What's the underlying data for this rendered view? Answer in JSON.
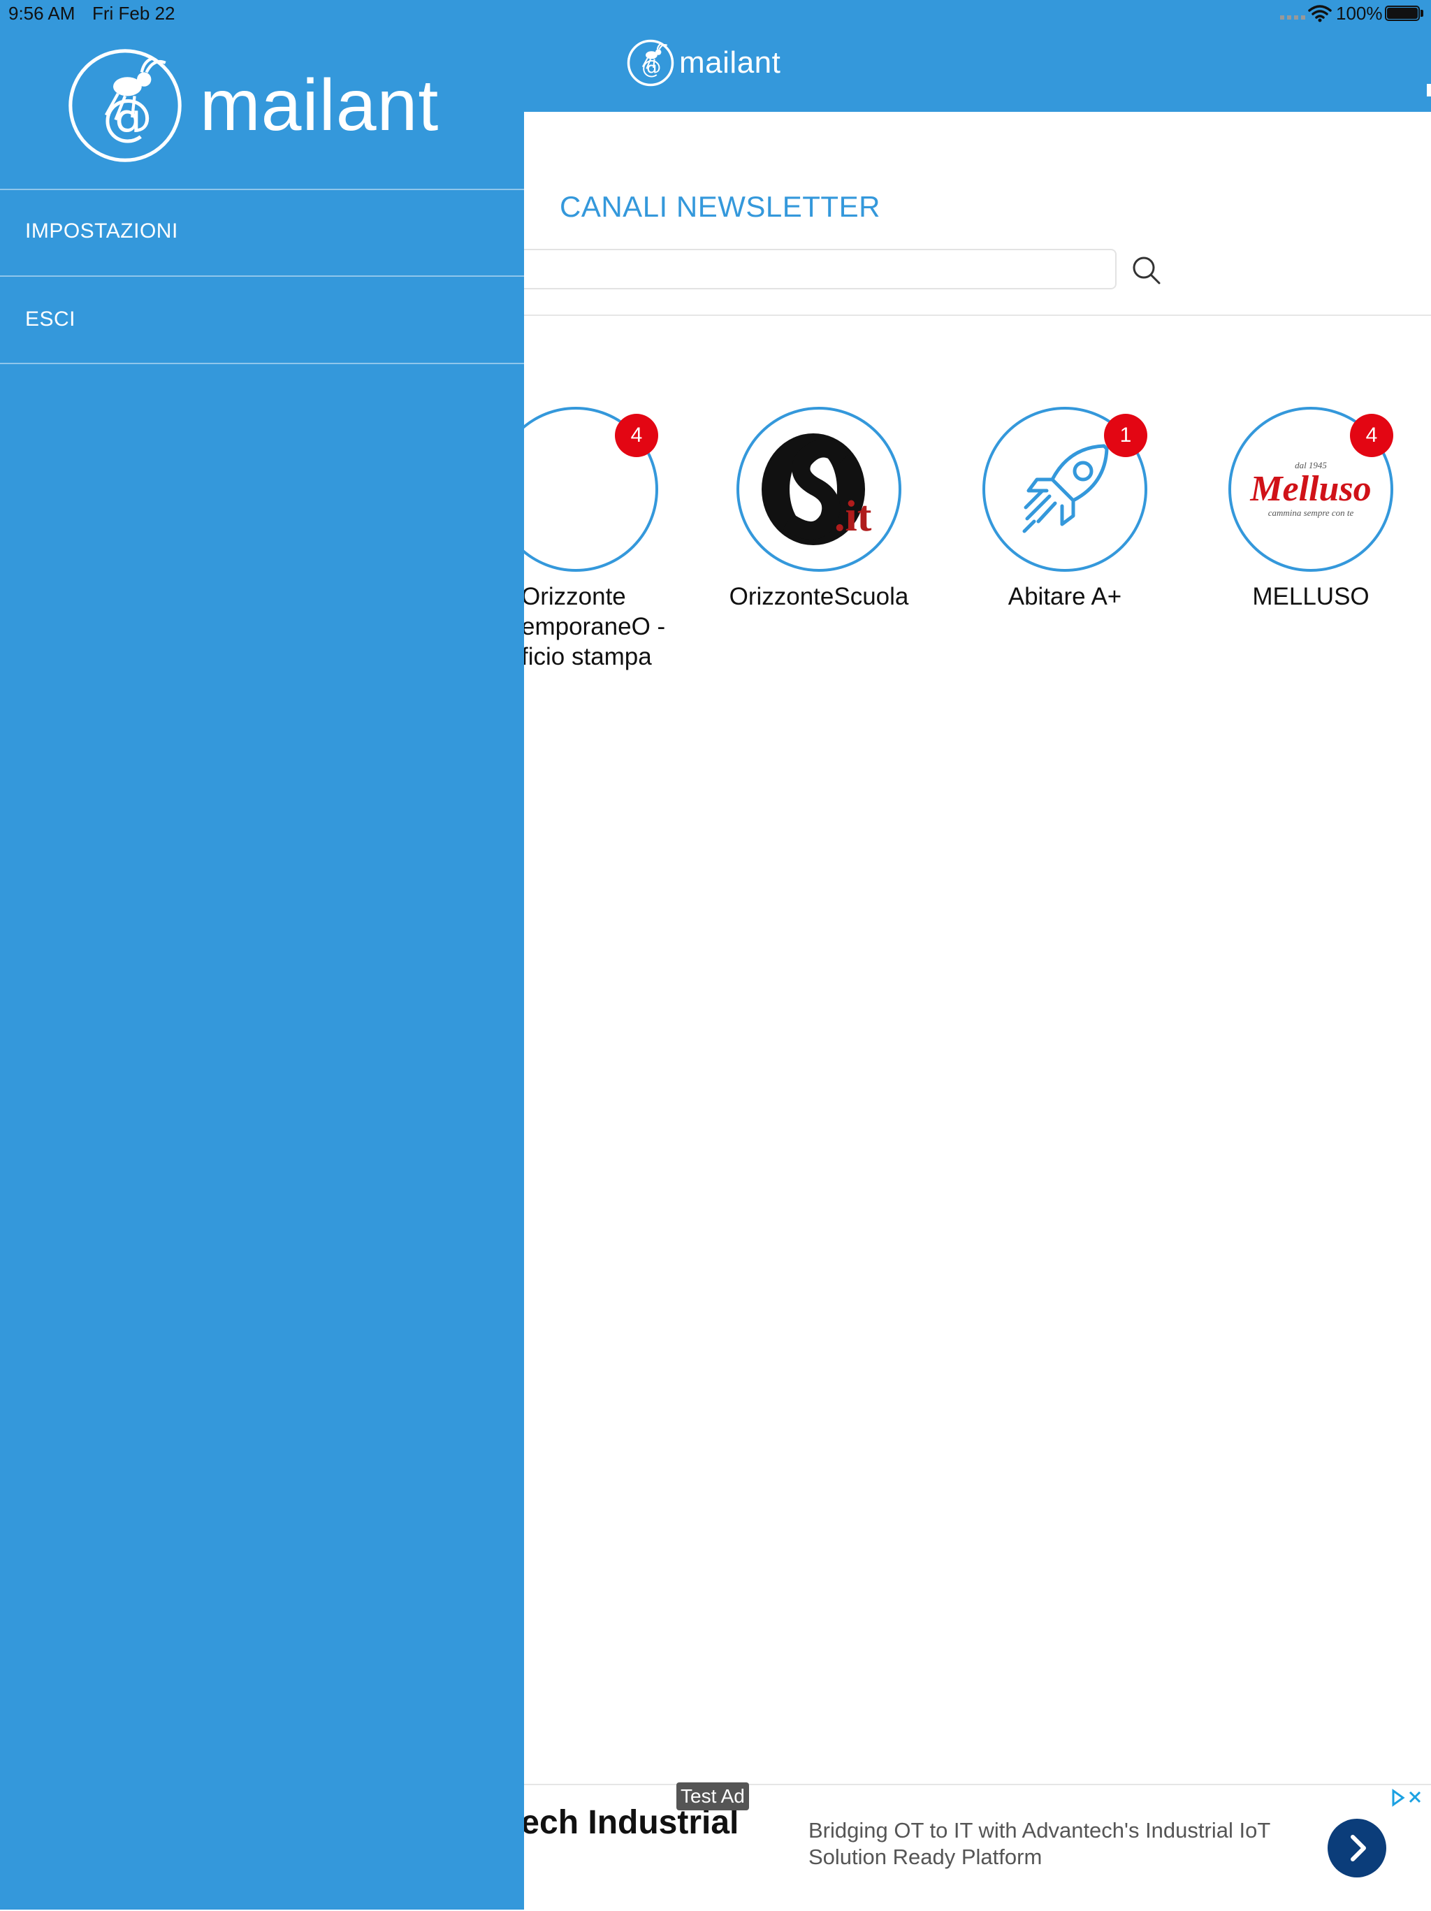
{
  "status_bar": {
    "time": "9:56 AM",
    "date": "Fri Feb 22",
    "battery": "100%"
  },
  "app": {
    "logo_text_regular": "mail",
    "logo_text_bold": "ant"
  },
  "drawer": {
    "items": [
      {
        "label": "IMPOSTAZIONI"
      },
      {
        "label": "ESCI"
      }
    ]
  },
  "main": {
    "title": "CANALI NEWSLETTER",
    "search": {
      "placeholder": "",
      "value": ""
    },
    "channels": [
      {
        "name": "Orizzonte\nemporaneO -\nficio stampa",
        "badge": "4"
      },
      {
        "name": "OrizzonteScuola",
        "badge": "",
        "logo_text": ".it"
      },
      {
        "name": "Abitare A+",
        "badge": "1"
      },
      {
        "name": "MELLUSO",
        "badge": "4",
        "logo_text": "Melluso",
        "logo_top": "dal 1945",
        "logo_bottom": "cammina sempre con te"
      }
    ]
  },
  "ad": {
    "label": "Test Ad",
    "headline": "ntech Industrial",
    "body": "Bridging OT to IT with Advantech's Industrial IoT Solution Ready Platform"
  },
  "colors": {
    "brand": "#3498db",
    "badge": "#e30613",
    "ad_button": "#0b3d7a"
  }
}
